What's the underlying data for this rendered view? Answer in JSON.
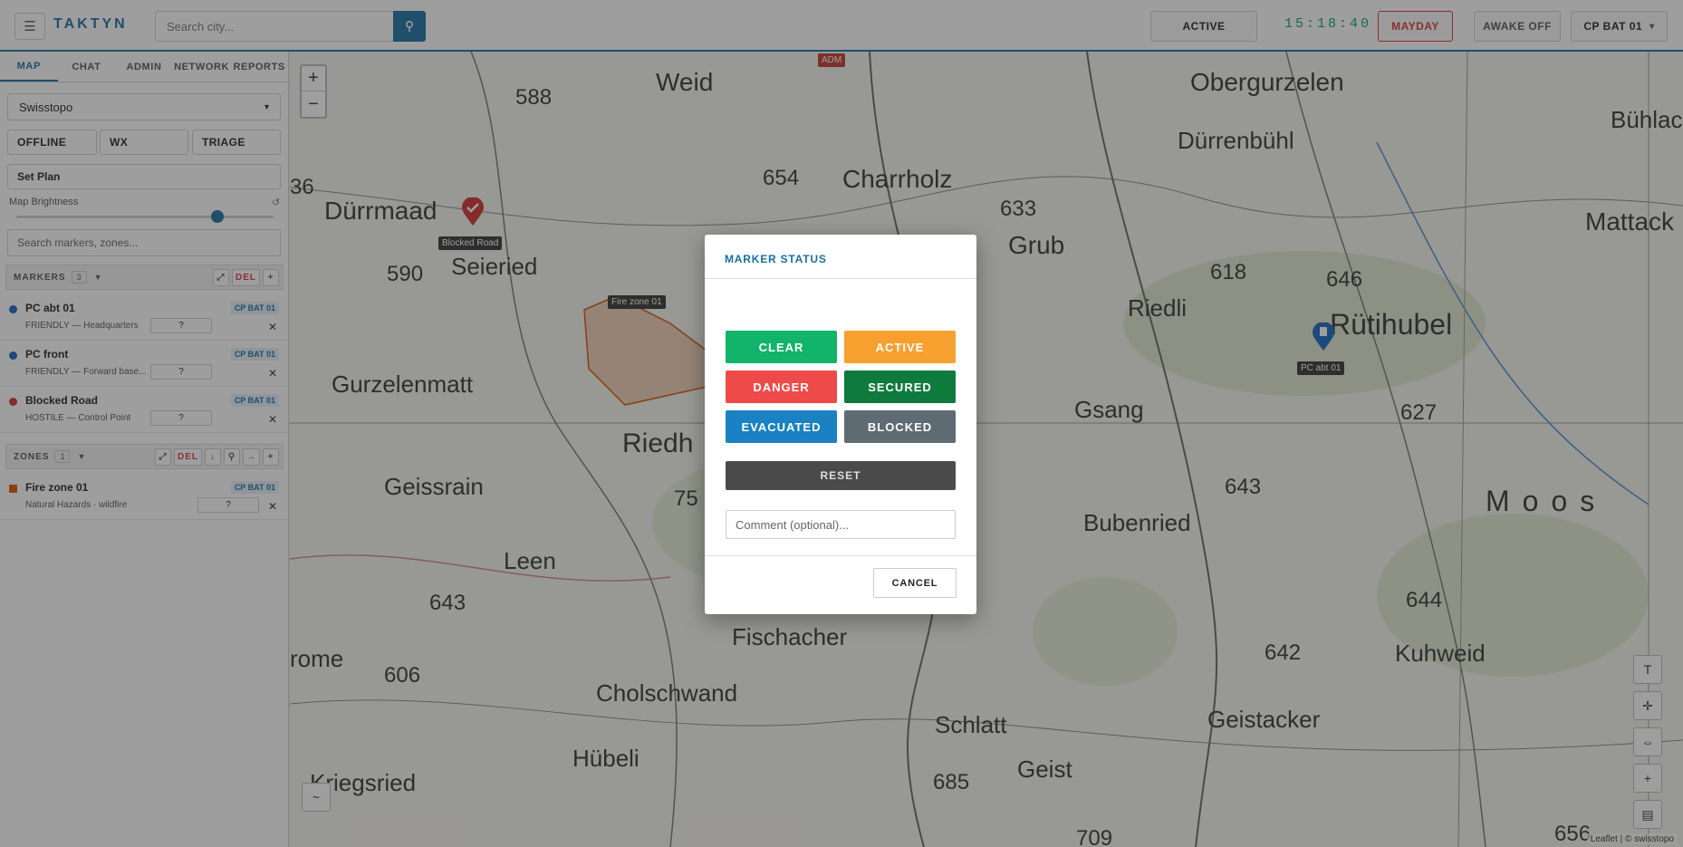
{
  "topbar": {
    "brand": "TAKTYN",
    "search_placeholder": "Search city...",
    "status": "ACTIVE",
    "clock": "15:18:40",
    "mayday": "MAYDAY",
    "awake": "AWAKE OFF",
    "unit": "CP BAT 01",
    "unit_caret": "▾",
    "menu_icon": "☰"
  },
  "sidebar": {
    "tabs": [
      "MAP",
      "CHAT",
      "ADMIN",
      "NETWORK",
      "REPORTS"
    ],
    "layer": "Swisstopo",
    "buttons": {
      "offline": "OFFLINE",
      "wx": "WX",
      "triage": "TRIAGE"
    },
    "set_plan": "Set Plan",
    "brightness_label": "Map Brightness",
    "brightness_value": 0.78,
    "search_placeholder": "Search markers, zones...",
    "markers": {
      "title": "MARKERS",
      "count": "3",
      "del": "DEL",
      "add": "+",
      "expand": "⤢",
      "caret": "▼",
      "items": [
        {
          "name": "PC abt 01",
          "sub": "FRIENDLY — Headquarters",
          "q": "?",
          "tag": "CP BAT 01",
          "color": "#1565c0"
        },
        {
          "name": "PC front",
          "sub": "FRIENDLY — Forward base...",
          "q": "?",
          "tag": "CP BAT 01",
          "color": "#1565c0"
        },
        {
          "name": "Blocked Road",
          "sub": "HOSTILE — Control Point",
          "q": "?",
          "tag": "CP BAT 01",
          "color": "#d32f2f"
        }
      ]
    },
    "zones": {
      "title": "ZONES",
      "count": "1",
      "del": "DEL",
      "caret": "▼",
      "down": "↓",
      "pin": "⚲",
      "arrow": "→",
      "add": "+",
      "expand": "⤢",
      "items": [
        {
          "name": "Fire zone 01",
          "sub": "Natural Hazards · wildfire",
          "q": "?",
          "tag": "CP BAT 01",
          "color": "#e65100"
        }
      ]
    }
  },
  "map": {
    "labels": {
      "blocked_road": "Blocked Road",
      "fire_zone": "Fire zone 01",
      "pc_abt": "PC abt 01",
      "adm": "ADM"
    },
    "attribution": "Leaflet | © swisstopo",
    "place_names": [
      "Weid",
      "Obergurzelen",
      "Dürrenbühl",
      "Bühlac",
      "Dürrmaad",
      "Charrholz",
      "Seieried",
      "Grub",
      "Mattack",
      "Riedli",
      "Rütihubel",
      "Gurzelenmatt",
      "Gsang",
      "Riedh",
      "Geissrain",
      "Bubenried",
      "Moos",
      "Leen",
      "Fischacher",
      "Cholschwand",
      "Kuhweid",
      "Schlatt",
      "Geistacker",
      "Hübeli",
      "Geist",
      "Kriegsried",
      "rome"
    ],
    "heights": [
      "588",
      "654",
      "633",
      "618",
      "646",
      "590",
      "36",
      "627",
      "643",
      "75",
      "643",
      "606",
      "642",
      "644",
      "685",
      "709",
      "656"
    ],
    "controls": {
      "zoom_in": "+",
      "zoom_out": "−",
      "text": "T",
      "crosshair": "✛",
      "measure": "⇔",
      "add": "+",
      "layers": "▤",
      "tilde": "~"
    }
  },
  "modal": {
    "title": "MARKER STATUS",
    "buttons": [
      {
        "label": "CLEAR",
        "color": "#12b36a"
      },
      {
        "label": "ACTIVE",
        "color": "#f7a02f"
      },
      {
        "label": "DANGER",
        "color": "#ef4a4a"
      },
      {
        "label": "SECURED",
        "color": "#0f7a3d"
      },
      {
        "label": "EVACUATED",
        "color": "#1a81c2"
      },
      {
        "label": "BLOCKED",
        "color": "#5f6b73"
      }
    ],
    "reset": "RESET",
    "comment_placeholder": "Comment (optional)...",
    "cancel": "CANCEL"
  }
}
